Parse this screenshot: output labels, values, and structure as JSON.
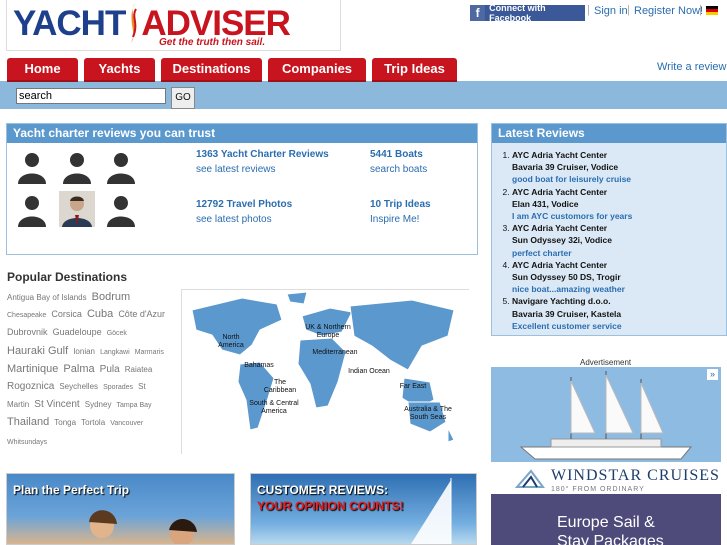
{
  "header": {
    "logo_left": "YACHT",
    "logo_right": "ADVISER",
    "tagline": "Get the truth then sail.",
    "facebook_label": "Connect with Facebook",
    "signin_label": "Sign in",
    "register_label": "Register Now!",
    "separator": "|"
  },
  "nav": {
    "tabs": [
      {
        "label": "Home"
      },
      {
        "label": "Yachts"
      },
      {
        "label": "Destinations"
      },
      {
        "label": "Companies"
      },
      {
        "label": "Trip Ideas"
      }
    ],
    "write_review": "Write a review"
  },
  "search": {
    "value": "search",
    "go_label": "GO"
  },
  "hero": {
    "title": "Yacht charter reviews you can trust",
    "stats": [
      {
        "num": "1363 Yacht Charter Reviews",
        "sub": "see latest reviews"
      },
      {
        "num": "5441 Boats",
        "sub": "search boats"
      },
      {
        "num": "12792 Travel Photos",
        "sub": "see latest photos"
      },
      {
        "num": "10 Trip Ideas",
        "sub": "Inspire Me!"
      }
    ]
  },
  "latest": {
    "title": "Latest Reviews",
    "items": [
      {
        "company": "AYC Adria Yacht Center",
        "boat": "Bavaria 39 Cruiser, Vodice",
        "quote": "good boat for leisurely cruise"
      },
      {
        "company": "AYC Adria Yacht Center",
        "boat": "Elan 431, Vodice",
        "quote": "I am AYC customors for years"
      },
      {
        "company": "AYC Adria Yacht Center",
        "boat": "Sun Odyssey 32i, Vodice",
        "quote": "perfect charter"
      },
      {
        "company": "AYC Adria Yacht Center",
        "boat": "Sun Odyssey 50 DS, Trogir",
        "quote": "nice boat...amazing weather"
      },
      {
        "company": "Navigare Yachting d.o.o.",
        "boat": "Bavaria 39 Cruiser, Kastela",
        "quote": "Excellent customer service"
      }
    ]
  },
  "popular": {
    "title": "Popular Destinations",
    "destinations": [
      {
        "name": "Antigua Bay of Islands",
        "size": 8
      },
      {
        "name": "Bodrum",
        "size": 11
      },
      {
        "name": "Chesapeake",
        "size": 7
      },
      {
        "name": "Corsica",
        "size": 9
      },
      {
        "name": "Cuba",
        "size": 11
      },
      {
        "name": "Côte d'Azur",
        "size": 9
      },
      {
        "name": "Dubrovnik",
        "size": 9
      },
      {
        "name": "Guadeloupe",
        "size": 9
      },
      {
        "name": "Göcek",
        "size": 7
      },
      {
        "name": "Hauraki Gulf",
        "size": 11
      },
      {
        "name": "Ionian",
        "size": 8
      },
      {
        "name": "Langkawi",
        "size": 7
      },
      {
        "name": "Marmaris",
        "size": 7
      },
      {
        "name": "Martinique",
        "size": 11
      },
      {
        "name": "Palma",
        "size": 11
      },
      {
        "name": "Pula",
        "size": 10
      },
      {
        "name": "Raiatea",
        "size": 8
      },
      {
        "name": "Rogoznica",
        "size": 10
      },
      {
        "name": "Seychelles",
        "size": 8
      },
      {
        "name": "Sporades",
        "size": 7
      },
      {
        "name": "St Martin",
        "size": 8
      },
      {
        "name": "St Vincent",
        "size": 10
      },
      {
        "name": "Sydney",
        "size": 8
      },
      {
        "name": "Tampa Bay",
        "size": 7
      },
      {
        "name": "Thailand",
        "size": 11
      },
      {
        "name": "Tonga",
        "size": 8
      },
      {
        "name": "Tortola",
        "size": 8
      },
      {
        "name": "Vancouver",
        "size": 7
      },
      {
        "name": "Whitsundays",
        "size": 7
      }
    ]
  },
  "map": {
    "labels": [
      "North America",
      "UK & Northern Europe",
      "Mediterranean",
      "Bahamas",
      "The Caribbean",
      "Indian Ocean",
      "Far East",
      "South & Central America",
      "Australia & The South Seas"
    ]
  },
  "ad": {
    "label": "Advertisement",
    "brand": "WINDSTAR CRUISES",
    "brand_tag": "180° FROM ORDINARY",
    "line1": "Europe Sail &",
    "line2": "Stay Packages",
    "close": "»"
  },
  "promos": {
    "trip_title": "Plan the Perfect Trip",
    "reviews_title": "CUSTOMER REVIEWS:",
    "reviews_sub": "YOUR OPINION COUNTS!"
  },
  "colors": {
    "brand_blue": "#1e3f8c",
    "brand_red": "#c8141e",
    "link_blue": "#2a6db0",
    "panel_blue": "#5a98cd",
    "nav_bar": "#8cb8dc",
    "facebook": "#3b5998"
  }
}
